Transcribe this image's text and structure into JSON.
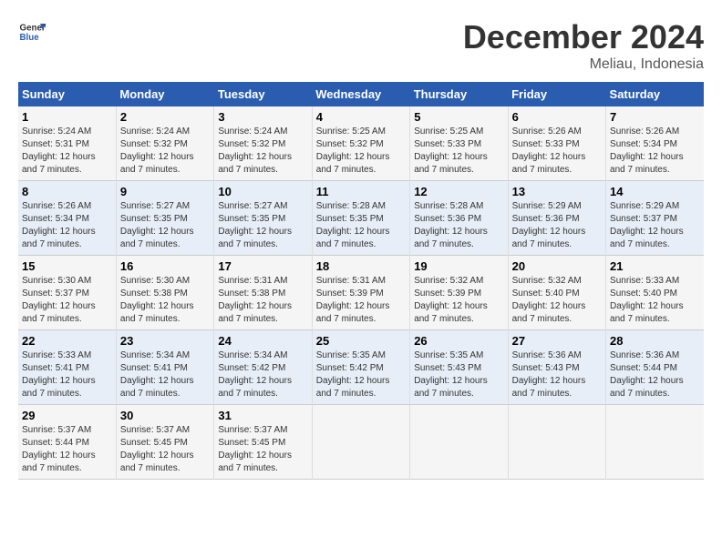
{
  "logo": {
    "line1": "General",
    "line2": "Blue"
  },
  "title": "December 2024",
  "subtitle": "Meliau, Indonesia",
  "weekdays": [
    "Sunday",
    "Monday",
    "Tuesday",
    "Wednesday",
    "Thursday",
    "Friday",
    "Saturday"
  ],
  "weeks": [
    [
      {
        "day": "1",
        "sunrise": "5:24 AM",
        "sunset": "5:31 PM",
        "daylight": "12 hours and 7 minutes."
      },
      {
        "day": "2",
        "sunrise": "5:24 AM",
        "sunset": "5:32 PM",
        "daylight": "12 hours and 7 minutes."
      },
      {
        "day": "3",
        "sunrise": "5:24 AM",
        "sunset": "5:32 PM",
        "daylight": "12 hours and 7 minutes."
      },
      {
        "day": "4",
        "sunrise": "5:25 AM",
        "sunset": "5:32 PM",
        "daylight": "12 hours and 7 minutes."
      },
      {
        "day": "5",
        "sunrise": "5:25 AM",
        "sunset": "5:33 PM",
        "daylight": "12 hours and 7 minutes."
      },
      {
        "day": "6",
        "sunrise": "5:26 AM",
        "sunset": "5:33 PM",
        "daylight": "12 hours and 7 minutes."
      },
      {
        "day": "7",
        "sunrise": "5:26 AM",
        "sunset": "5:34 PM",
        "daylight": "12 hours and 7 minutes."
      }
    ],
    [
      {
        "day": "8",
        "sunrise": "5:26 AM",
        "sunset": "5:34 PM",
        "daylight": "12 hours and 7 minutes."
      },
      {
        "day": "9",
        "sunrise": "5:27 AM",
        "sunset": "5:35 PM",
        "daylight": "12 hours and 7 minutes."
      },
      {
        "day": "10",
        "sunrise": "5:27 AM",
        "sunset": "5:35 PM",
        "daylight": "12 hours and 7 minutes."
      },
      {
        "day": "11",
        "sunrise": "5:28 AM",
        "sunset": "5:35 PM",
        "daylight": "12 hours and 7 minutes."
      },
      {
        "day": "12",
        "sunrise": "5:28 AM",
        "sunset": "5:36 PM",
        "daylight": "12 hours and 7 minutes."
      },
      {
        "day": "13",
        "sunrise": "5:29 AM",
        "sunset": "5:36 PM",
        "daylight": "12 hours and 7 minutes."
      },
      {
        "day": "14",
        "sunrise": "5:29 AM",
        "sunset": "5:37 PM",
        "daylight": "12 hours and 7 minutes."
      }
    ],
    [
      {
        "day": "15",
        "sunrise": "5:30 AM",
        "sunset": "5:37 PM",
        "daylight": "12 hours and 7 minutes."
      },
      {
        "day": "16",
        "sunrise": "5:30 AM",
        "sunset": "5:38 PM",
        "daylight": "12 hours and 7 minutes."
      },
      {
        "day": "17",
        "sunrise": "5:31 AM",
        "sunset": "5:38 PM",
        "daylight": "12 hours and 7 minutes."
      },
      {
        "day": "18",
        "sunrise": "5:31 AM",
        "sunset": "5:39 PM",
        "daylight": "12 hours and 7 minutes."
      },
      {
        "day": "19",
        "sunrise": "5:32 AM",
        "sunset": "5:39 PM",
        "daylight": "12 hours and 7 minutes."
      },
      {
        "day": "20",
        "sunrise": "5:32 AM",
        "sunset": "5:40 PM",
        "daylight": "12 hours and 7 minutes."
      },
      {
        "day": "21",
        "sunrise": "5:33 AM",
        "sunset": "5:40 PM",
        "daylight": "12 hours and 7 minutes."
      }
    ],
    [
      {
        "day": "22",
        "sunrise": "5:33 AM",
        "sunset": "5:41 PM",
        "daylight": "12 hours and 7 minutes."
      },
      {
        "day": "23",
        "sunrise": "5:34 AM",
        "sunset": "5:41 PM",
        "daylight": "12 hours and 7 minutes."
      },
      {
        "day": "24",
        "sunrise": "5:34 AM",
        "sunset": "5:42 PM",
        "daylight": "12 hours and 7 minutes."
      },
      {
        "day": "25",
        "sunrise": "5:35 AM",
        "sunset": "5:42 PM",
        "daylight": "12 hours and 7 minutes."
      },
      {
        "day": "26",
        "sunrise": "5:35 AM",
        "sunset": "5:43 PM",
        "daylight": "12 hours and 7 minutes."
      },
      {
        "day": "27",
        "sunrise": "5:36 AM",
        "sunset": "5:43 PM",
        "daylight": "12 hours and 7 minutes."
      },
      {
        "day": "28",
        "sunrise": "5:36 AM",
        "sunset": "5:44 PM",
        "daylight": "12 hours and 7 minutes."
      }
    ],
    [
      {
        "day": "29",
        "sunrise": "5:37 AM",
        "sunset": "5:44 PM",
        "daylight": "12 hours and 7 minutes."
      },
      {
        "day": "30",
        "sunrise": "5:37 AM",
        "sunset": "5:45 PM",
        "daylight": "12 hours and 7 minutes."
      },
      {
        "day": "31",
        "sunrise": "5:37 AM",
        "sunset": "5:45 PM",
        "daylight": "12 hours and 7 minutes."
      },
      null,
      null,
      null,
      null
    ]
  ],
  "labels": {
    "sunrise": "Sunrise:",
    "sunset": "Sunset:",
    "daylight": "Daylight:"
  }
}
